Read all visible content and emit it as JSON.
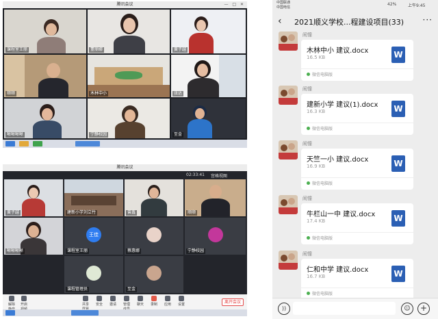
{
  "meeting_top": {
    "window_title": "腾讯会议",
    "window_controls": "— □ ✕",
    "tiles": [
      {
        "label": "课程室王丽"
      },
      {
        "label": "董丽娜"
      },
      {
        "label": "黄子越"
      },
      {
        "label": "顺顺"
      },
      {
        "label": "木林中小"
      },
      {
        "label": "张达"
      },
      {
        "label": "晰晰晰晰"
      },
      {
        "label": "宁静校园"
      },
      {
        "label": "至金"
      }
    ]
  },
  "meeting_bottom": {
    "window_title": "腾讯会议",
    "time": "02:33:41",
    "view_label": "宫格视图",
    "tiles": [
      {
        "label": "黄子越"
      },
      {
        "label": "建新小学刘立竹"
      },
      {
        "label": "曾鑫"
      },
      {
        "label": "顺顺"
      },
      {
        "label": "晰晰晰晰"
      },
      {
        "label": "课程室王丽"
      },
      {
        "label": "蔡惠娜"
      },
      {
        "label": "宁静校园"
      },
      {
        "label": "课程管理员"
      },
      {
        "label": "至金"
      }
    ],
    "avatar_text": "王佳",
    "toolbar": [
      {
        "label": "解除静音"
      },
      {
        "label": "开启视频"
      },
      {
        "label": "共享屏幕"
      },
      {
        "label": "安全"
      },
      {
        "label": "邀请"
      },
      {
        "label": "管理成员"
      },
      {
        "label": "聊天"
      },
      {
        "label": "录制"
      },
      {
        "label": "应用"
      },
      {
        "label": "设置"
      }
    ],
    "leave_label": "离开会议"
  },
  "phone": {
    "status": {
      "carrier1": "中国联通",
      "carrier2": "中国电信",
      "battery": "42%",
      "time": "上午9:45"
    },
    "chat_title": "2021顺义学校...程建设项目(33)",
    "back_icon": "‹",
    "more_icon": "···",
    "messages": [
      {
        "sender": "闹憧",
        "file_name": "木林中小 建议.docx",
        "file_size": "16.5 KB",
        "source": "微信电脑版"
      },
      {
        "sender": "闹憧",
        "file_name": "建新小学 建议(1).docx",
        "file_size": "16.3 KB",
        "source": "微信电脑版"
      },
      {
        "sender": "闹憧",
        "file_name": "天竺一小 建议.docx",
        "file_size": "16.9 KB",
        "source": "微信电脑版"
      },
      {
        "sender": "闹憧",
        "file_name": "牛栏山一中 建议.docx",
        "file_size": "17.4 KB",
        "source": "微信电脑版"
      },
      {
        "sender": "闹憧",
        "file_name": "仁和中学 建议.docx",
        "file_size": "16.7 KB",
        "source": "微信电脑版"
      }
    ],
    "word_icon": "W",
    "input": {
      "voice_icon": "))",
      "emoji_icon": "☺",
      "plus_icon": "+"
    }
  }
}
